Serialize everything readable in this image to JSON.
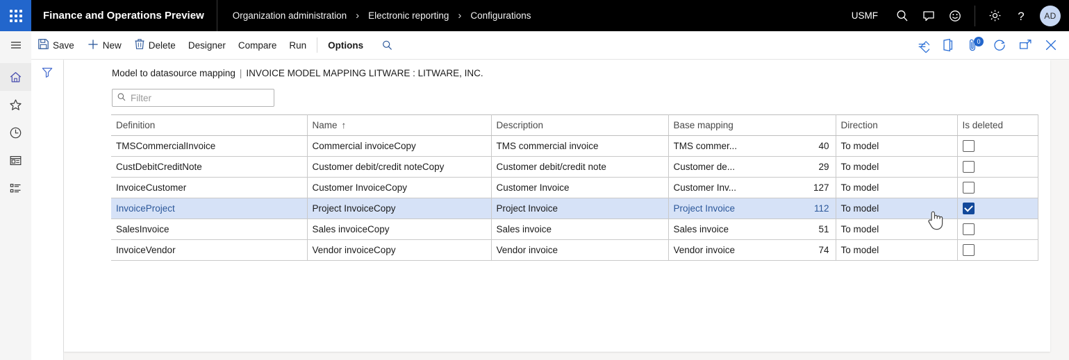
{
  "topbar": {
    "waffle_label": "app-launcher",
    "app_title": "Finance and Operations Preview",
    "breadcrumb": [
      {
        "label": "Organization administration"
      },
      {
        "label": "Electronic reporting"
      },
      {
        "label": "Configurations"
      }
    ],
    "breadcrumb_separator": "›",
    "company": "USMF",
    "icons": [
      {
        "name": "search-icon"
      },
      {
        "name": "message-icon"
      },
      {
        "name": "feedback-smiley-icon"
      },
      {
        "name": "settings-gear-icon"
      },
      {
        "name": "help-question-icon"
      }
    ],
    "avatar_initials": "AD"
  },
  "rail": {
    "items": [
      {
        "name": "hamburger-menu-icon",
        "label": "Expand navigation"
      },
      {
        "name": "home-icon",
        "label": "Home"
      },
      {
        "name": "star-favorites-icon",
        "label": "Favorites"
      },
      {
        "name": "clock-recent-icon",
        "label": "Recent"
      },
      {
        "name": "workspaces-icon",
        "label": "Workspaces"
      },
      {
        "name": "modules-list-icon",
        "label": "Modules"
      }
    ]
  },
  "commandbar": {
    "buttons": [
      {
        "label": "Save",
        "icon": "save-floppy-icon"
      },
      {
        "label": "New",
        "icon": "plus-icon"
      },
      {
        "label": "Delete",
        "icon": "trash-icon"
      },
      {
        "label": "Designer",
        "icon": ""
      },
      {
        "label": "Compare",
        "icon": ""
      },
      {
        "label": "Run",
        "icon": ""
      }
    ],
    "options_label": "Options",
    "search_icon": "search-icon",
    "right_icons": [
      {
        "name": "powerbi-diamond-icon"
      },
      {
        "name": "office-app-icon"
      },
      {
        "name": "attachments-icon",
        "badge": "0"
      },
      {
        "name": "refresh-icon"
      },
      {
        "name": "popout-icon"
      },
      {
        "name": "close-icon"
      }
    ]
  },
  "filterpane": {
    "funnel_icon": "filter-funnel-icon"
  },
  "page": {
    "title": "Model to datasource mapping",
    "separator": "|",
    "subtitle": "INVOICE MODEL MAPPING LITWARE : LITWARE, INC."
  },
  "filter": {
    "placeholder": "Filter",
    "value": "",
    "icon": "search-icon"
  },
  "grid": {
    "columns": [
      {
        "key": "definition",
        "label": "Definition",
        "sort": ""
      },
      {
        "key": "name",
        "label": "Name",
        "sort": "↑"
      },
      {
        "key": "description",
        "label": "Description",
        "sort": ""
      },
      {
        "key": "base_mapping",
        "label": "Base mapping",
        "sort": ""
      },
      {
        "key": "direction",
        "label": "Direction",
        "sort": ""
      },
      {
        "key": "is_deleted",
        "label": "Is deleted",
        "sort": ""
      }
    ],
    "rows": [
      {
        "definition": "TMSCommercialInvoice",
        "name": "Commercial invoiceCopy",
        "description": "TMS commercial invoice",
        "base_mapping_text": "TMS commer...",
        "base_mapping_number": "40",
        "direction": "To model",
        "is_deleted": false,
        "selected": false
      },
      {
        "definition": "CustDebitCreditNote",
        "name": "Customer debit/credit noteCopy",
        "description": "Customer debit/credit note",
        "base_mapping_text": "Customer de...",
        "base_mapping_number": "29",
        "direction": "To model",
        "is_deleted": false,
        "selected": false
      },
      {
        "definition": "InvoiceCustomer",
        "name": "Customer InvoiceCopy",
        "description": "Customer Invoice",
        "base_mapping_text": "Customer Inv...",
        "base_mapping_number": "127",
        "direction": "To model",
        "is_deleted": false,
        "selected": false
      },
      {
        "definition": "InvoiceProject",
        "name": "Project InvoiceCopy",
        "description": "Project Invoice",
        "base_mapping_text": "Project Invoice",
        "base_mapping_number": "112",
        "direction": "To model",
        "is_deleted": true,
        "selected": true
      },
      {
        "definition": "SalesInvoice",
        "name": "Sales invoiceCopy",
        "description": "Sales invoice",
        "base_mapping_text": "Sales invoice",
        "base_mapping_number": "51",
        "direction": "To model",
        "is_deleted": false,
        "selected": false
      },
      {
        "definition": "InvoiceVendor",
        "name": "Vendor invoiceCopy",
        "description": "Vendor invoice",
        "base_mapping_text": "Vendor invoice",
        "base_mapping_number": "74",
        "direction": "To model",
        "is_deleted": false,
        "selected": false
      }
    ]
  },
  "colors": {
    "accent": "#2266cc",
    "selected_row": "#d6e2f7",
    "link": "#2b579a",
    "checkbox_checked": "#12499b",
    "topbar_bg": "#000000"
  },
  "cursor": {
    "name": "pointing-hand-cursor"
  }
}
